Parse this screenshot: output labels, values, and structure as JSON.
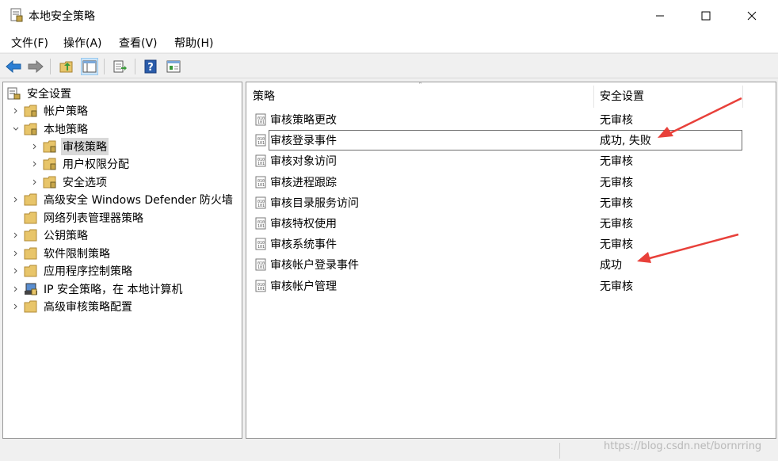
{
  "window": {
    "title": "本地安全策略",
    "app_icon": "security-policy-icon",
    "minimize_icon": "minimize-icon",
    "maximize_icon": "maximize-icon",
    "close_icon": "close-icon"
  },
  "menu": [
    "文件(F)",
    "操作(A)",
    "查看(V)",
    "帮助(H)"
  ],
  "toolbar": {
    "icons": [
      "back-arrow-icon",
      "forward-arrow-icon",
      "up-folder-icon",
      "show-hide-tree-icon",
      "export-list-icon",
      "help-icon",
      "properties-icon"
    ]
  },
  "tree": {
    "root": "安全设置",
    "items": [
      {
        "label": "帐户策略",
        "expander": "collapsed"
      },
      {
        "label": "本地策略",
        "expander": "expanded"
      },
      {
        "label": "审核策略",
        "expander": "collapsed",
        "selected": true
      },
      {
        "label": "用户权限分配",
        "expander": "collapsed"
      },
      {
        "label": "安全选项",
        "expander": "collapsed"
      },
      {
        "label": "高级安全 Windows Defender 防火墙",
        "expander": "collapsed"
      },
      {
        "label": "网络列表管理器策略",
        "expander": "none"
      },
      {
        "label": "公钥策略",
        "expander": "collapsed"
      },
      {
        "label": "软件限制策略",
        "expander": "collapsed"
      },
      {
        "label": "应用程序控制策略",
        "expander": "collapsed"
      },
      {
        "label": "IP 安全策略，在 本地计算机",
        "expander": "collapsed"
      },
      {
        "label": "高级审核策略配置",
        "expander": "collapsed"
      }
    ]
  },
  "list": {
    "columns": [
      "策略",
      "安全设置"
    ],
    "rows": [
      {
        "policy": "审核策略更改",
        "setting": "无审核"
      },
      {
        "policy": "审核登录事件",
        "setting": "成功, 失败",
        "focused": true
      },
      {
        "policy": "审核对象访问",
        "setting": "无审核"
      },
      {
        "policy": "审核进程跟踪",
        "setting": "无审核"
      },
      {
        "policy": "审核目录服务访问",
        "setting": "无审核"
      },
      {
        "policy": "审核特权使用",
        "setting": "无审核"
      },
      {
        "policy": "审核系统事件",
        "setting": "无审核"
      },
      {
        "policy": "审核帐户登录事件",
        "setting": "成功"
      },
      {
        "policy": "审核帐户管理",
        "setting": "无审核"
      }
    ]
  },
  "watermark": "https://blog.csdn.net/bornrring",
  "colors": {
    "annotation_arrow": "#e8403a",
    "selection": "#d9d9d9",
    "folder": "#e8c56a"
  }
}
